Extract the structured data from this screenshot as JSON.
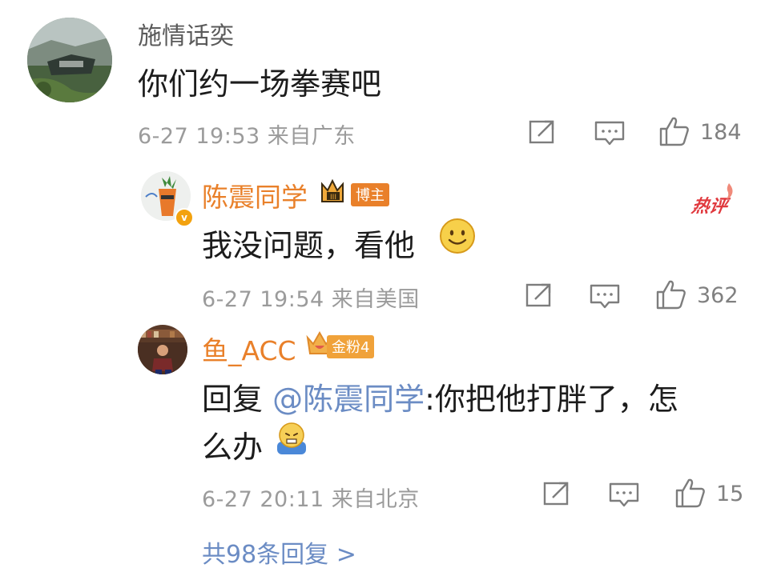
{
  "comments": [
    {
      "username": "施情话奕",
      "content": "你们约一场拳赛吧",
      "meta": "6-27 19:53 来自广东",
      "likes": "184",
      "avatar": "landscape-avatar"
    },
    {
      "username": "陈震同学",
      "badge": "博主",
      "hot_label": "热评",
      "content": "我没问题，看他",
      "meta": "6-27 19:54 来自美国",
      "likes": "362",
      "avatar": "carrot-avatar"
    },
    {
      "username": "鱼_ACC",
      "badge": "金粉4",
      "reply_prefix": "回复 ",
      "mention": "@陈震同学",
      "content_line1": ":你把他打胖了，怎",
      "content_line2": "么办",
      "meta": "6-27 20:11 来自北京",
      "likes": "15",
      "avatar": "bookshelf-avatar"
    }
  ],
  "more_replies": "共98条回复 >",
  "colors": {
    "accent_orange": "#e9802a",
    "link_blue": "#6b8cc4",
    "meta_gray": "#9b9b9b",
    "hot_red": "#e0393e"
  }
}
